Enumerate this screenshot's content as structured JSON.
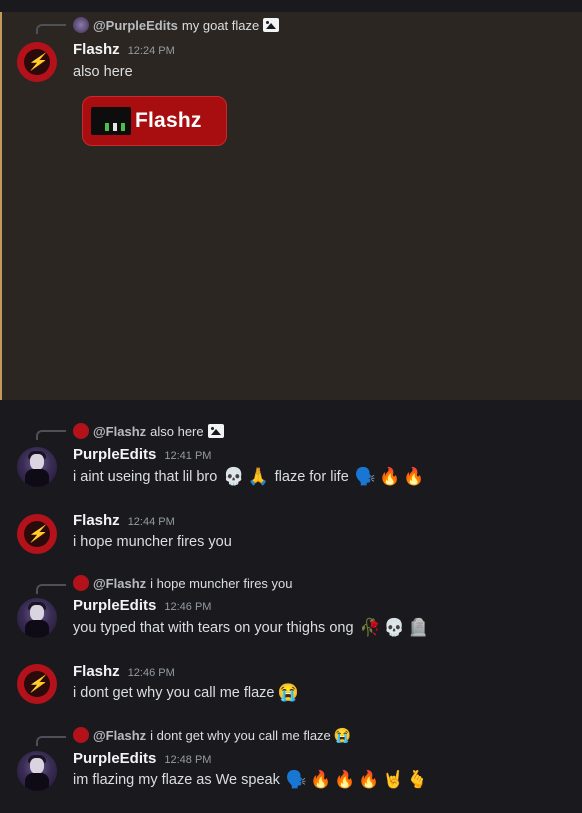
{
  "messages": [
    {
      "reply": {
        "mention": "@PurpleEdits",
        "preview": "my goat flaze",
        "has_image": true
      },
      "username": "Flashz",
      "timestamp": "12:24 PM",
      "text": "also here",
      "embed": {
        "label": "Flashz"
      },
      "highlighted": true
    },
    {
      "reply": {
        "mention": "@Flashz",
        "preview": "also here",
        "has_image": true
      },
      "username": "PurpleEdits",
      "timestamp": "12:41 PM",
      "text": "i aint useing that lil bro",
      "emojis_a": [
        "💀",
        "🙏"
      ],
      "text_b": "flaze for life",
      "emojis_b": [
        "🗣️",
        "🔥",
        "🔥"
      ]
    },
    {
      "username": "Flashz",
      "timestamp": "12:44 PM",
      "text": "i hope muncher fires you"
    },
    {
      "reply": {
        "mention": "@Flashz",
        "preview": "i hope muncher fires you",
        "has_image": false
      },
      "username": "PurpleEdits",
      "timestamp": "12:46 PM",
      "text": "you typed that with tears on your thighs ong",
      "emojis": [
        "🥀",
        "💀",
        "🪦"
      ]
    },
    {
      "username": "Flashz",
      "timestamp": "12:46 PM",
      "text": "i dont get why you call me flaze",
      "emojis": [
        "😭"
      ]
    },
    {
      "reply": {
        "mention": "@Flashz",
        "preview": "i dont get why you call me flaze",
        "emoji": "😭"
      },
      "username": "PurpleEdits",
      "timestamp": "12:48 PM",
      "text": "im flazing my flaze as We speak",
      "emojis": [
        "🗣️",
        "🔥",
        "🔥",
        "🔥",
        "🤘",
        "🫰"
      ]
    }
  ],
  "colors": {
    "flashz_avatar": "#b3121a",
    "highlight_bg": "#2b2621",
    "highlight_border": "#c49a5a"
  }
}
